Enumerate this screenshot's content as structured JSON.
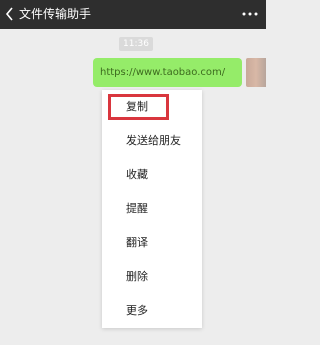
{
  "header": {
    "title": "文件传输助手",
    "back_icon": "chevron-left-icon",
    "more_icon": "ellipsis-icon"
  },
  "chat": {
    "time": "11:36",
    "message": "https://www.taobao.com/",
    "bubble_color": "#95ec69"
  },
  "context_menu": {
    "items": [
      {
        "label": "复制"
      },
      {
        "label": "发送给朋友"
      },
      {
        "label": "收藏"
      },
      {
        "label": "提醒"
      },
      {
        "label": "翻译"
      },
      {
        "label": "删除"
      },
      {
        "label": "更多"
      }
    ],
    "highlight_color": "#d9363e"
  }
}
